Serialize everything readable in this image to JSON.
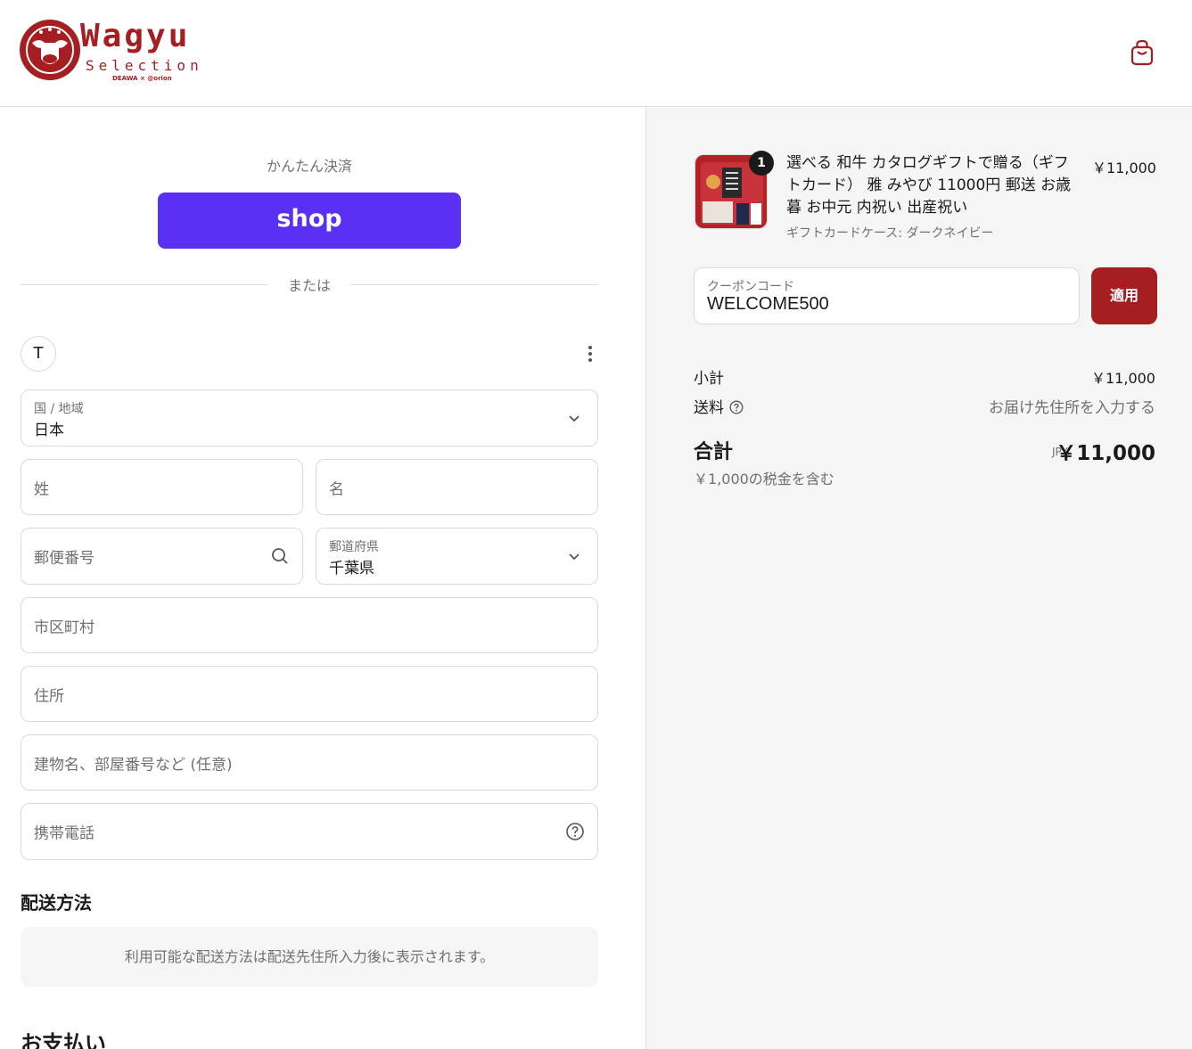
{
  "colors": {
    "brand": "#a51e22",
    "shop_pay": "#5a31f4",
    "muted": "#707070",
    "summary_bg": "#f5f5f5"
  },
  "header": {
    "logo": {
      "word": "Wagyu",
      "sub": "Selection",
      "tiny": "DEAWA × @orion"
    },
    "cart_icon": "shopping-bag-icon"
  },
  "express": {
    "label": "かんたん決済",
    "shop_button": "shop",
    "or_label": "または"
  },
  "account": {
    "avatar_initial": "T",
    "menu_icon": "more-vertical-icon"
  },
  "form": {
    "country": {
      "label": "国 / 地域",
      "value": "日本"
    },
    "last_name": {
      "placeholder": "姓"
    },
    "first_name": {
      "placeholder": "名"
    },
    "postal": {
      "placeholder": "郵便番号",
      "icon": "search-icon"
    },
    "prefecture": {
      "label": "郵道府県",
      "value": "千葉県"
    },
    "city": {
      "placeholder": "市区町村"
    },
    "address": {
      "placeholder": "住所"
    },
    "building": {
      "placeholder": "建物名、部屋番号など (任意)"
    },
    "phone": {
      "placeholder": "携帯電話",
      "icon": "help-icon"
    }
  },
  "shipping": {
    "title": "配送方法",
    "note": "利用可能な配送方法は配送先住所入力後に表示されます。"
  },
  "payment": {
    "title": "お支払い"
  },
  "order": {
    "item": {
      "quantity": "1",
      "name": "選べる 和牛 カタログギフトで贈る（ギフトカード） 雅 みやび 11000円 郵送 お歳暮 お中元 内祝い 出産祝い",
      "variant": "ギフトカードケース: ダークネイビー",
      "price": "￥11,000"
    },
    "coupon": {
      "label": "クーポンコード",
      "value": "WELCOME500",
      "apply_label": "適用"
    },
    "subtotal": {
      "label": "小計",
      "value": "￥11,000"
    },
    "shipping": {
      "label": "送料",
      "value": "お届け先住所を入力する"
    },
    "total": {
      "label": "合計",
      "currency": "JPY",
      "value": "￥11,000"
    },
    "tax_note": "￥1,000の税金を含む"
  }
}
